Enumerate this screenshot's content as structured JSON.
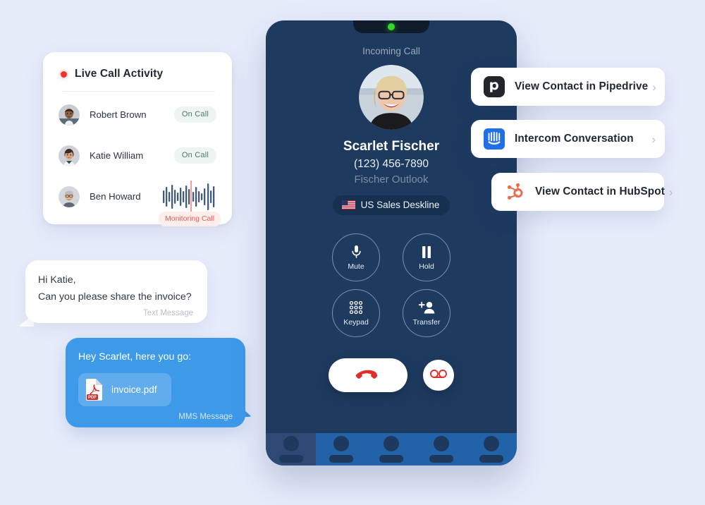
{
  "theme": {
    "page_bg": "#e7ecfb",
    "phone_bg": "#1e3a5f",
    "accent_blue": "#3d9ae8",
    "dock_blue": "#2262a8",
    "red": "#e02f2a",
    "green_led": "#37d62a"
  },
  "live_call_activity": {
    "title": "Live Call Activity",
    "status_dot": "live-indicator-dot",
    "rows": [
      {
        "name": "Robert Brown",
        "status": "On Call",
        "type": "badge"
      },
      {
        "name": "Katie William",
        "status": "On Call",
        "type": "badge"
      },
      {
        "name": "Ben Howard",
        "status": "Monitoring Call",
        "type": "waveform"
      }
    ]
  },
  "messages": {
    "incoming": {
      "line1": "Hi Katie,",
      "line2": "Can you please share the invoice?",
      "tag": "Text Message"
    },
    "outgoing": {
      "line1": "Hey Scarlet, here you go:",
      "attachment": {
        "filename": "invoice.pdf",
        "badge": "PDF"
      },
      "tag": "MMS Message"
    }
  },
  "phone": {
    "call_status": "Incoming Call",
    "contact_name": "Scarlet Fischer",
    "contact_phone": "(123) 456-7890",
    "contact_source": "Fischer Outlook",
    "deskline": {
      "flag": "us-flag-icon",
      "label": "US Sales Deskline"
    },
    "controls": [
      {
        "label": "Mute",
        "icon": "microphone-icon"
      },
      {
        "label": "Hold",
        "icon": "pause-icon"
      },
      {
        "label": "Keypad",
        "icon": "dialpad-icon"
      },
      {
        "label": "Transfer",
        "icon": "add-person-icon"
      }
    ],
    "actions": {
      "end_call": "end-call-button",
      "voicemail": "voicemail-button"
    },
    "dock_items": 5,
    "dock_active_index": 0
  },
  "integrations": [
    {
      "id": "pipedrive",
      "label": "View Contact in Pipedrive",
      "icon": "pipedrive-icon",
      "chevron": "›"
    },
    {
      "id": "intercom",
      "label": "Intercom Conversation",
      "icon": "intercom-icon",
      "chevron": "›"
    },
    {
      "id": "hubspot",
      "label": "View Contact in HubSpot",
      "icon": "hubspot-icon",
      "chevron": "›"
    }
  ]
}
